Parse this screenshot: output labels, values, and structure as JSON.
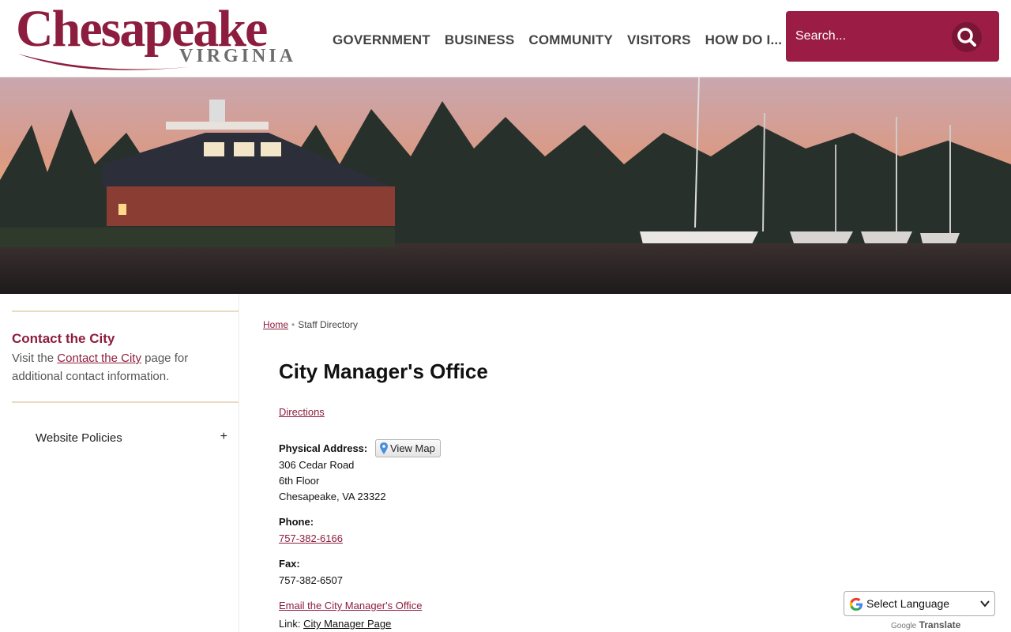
{
  "header": {
    "logo_main": "Chesapeake",
    "logo_sub": "VIRGINIA",
    "nav": [
      "GOVERNMENT",
      "BUSINESS",
      "COMMUNITY",
      "VISITORS",
      "HOW DO I..."
    ],
    "search_placeholder": "Search..."
  },
  "colors": {
    "brand": "#8d1d3e",
    "search_bg": "#9b1c45",
    "sidebar_rule": "#eadcc3"
  },
  "icons": {
    "search": "magnifier-icon",
    "map_pin": "map-pin-icon",
    "google": "google-g-icon",
    "expand": "plus-icon"
  },
  "sidebar": {
    "contact_title": "Contact the City",
    "contact_pre": "Visit the ",
    "contact_link": "Contact the City",
    "contact_post": " page for additional contact information.",
    "policies_label": "Website Policies",
    "policies_toggle": "+"
  },
  "breadcrumb": {
    "home": "Home",
    "sep": "•",
    "current": "Staff Directory"
  },
  "main": {
    "title": "City Manager's Office",
    "directions": "Directions",
    "address_label": "Physical Address:",
    "view_map": "View Map",
    "address_lines": [
      "306 Cedar Road",
      "6th Floor",
      "Chesapeake, VA 23322"
    ],
    "phone_label": "Phone:",
    "phone": "757-382-6166",
    "fax_label": "Fax:",
    "fax": "757-382-6507",
    "email_link": "Email the City Manager's Office",
    "link_prefix": "Link: ",
    "link_text": "City Manager Page"
  },
  "translate": {
    "select_label": "Select Language",
    "powered_google": "Google",
    "powered_translate": "Translate"
  }
}
